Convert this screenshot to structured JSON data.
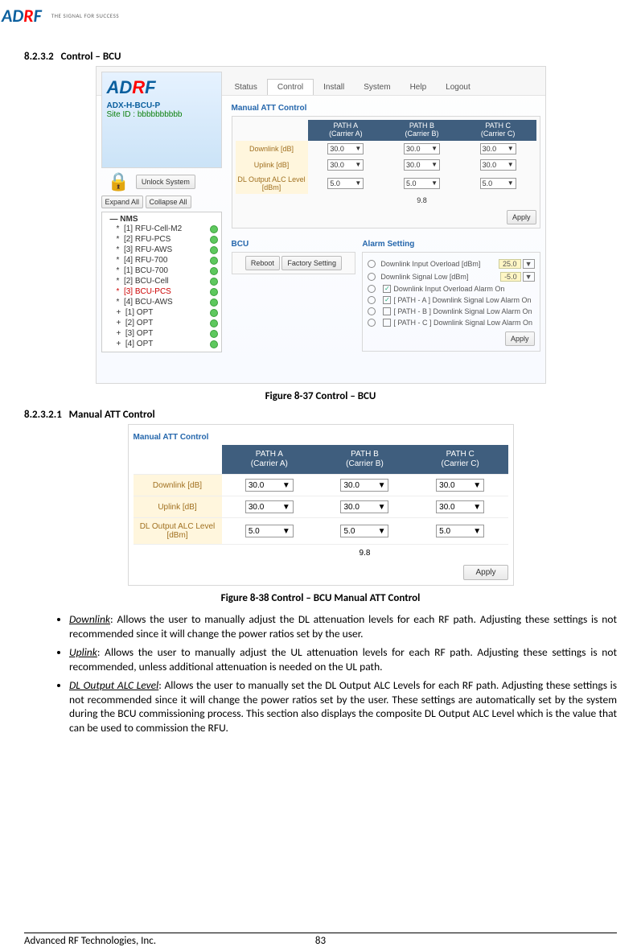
{
  "header": {
    "logo_text_AD": "AD",
    "logo_text_R": "R",
    "logo_text_F": "F",
    "logo_tagline": "THE SIGNAL FOR SUCCESS"
  },
  "section": {
    "num": "8.2.3.2",
    "title": "Control – BCU"
  },
  "figure1": {
    "caption": "Figure 8-37    Control – BCU",
    "tabs": [
      "Status",
      "Control",
      "Install",
      "System",
      "Help",
      "Logout"
    ],
    "active_tab": "Control",
    "device_name": "ADX-H-BCU-P",
    "site_id_label": "Site ID :",
    "site_id_value": "bbbbbbbbbb",
    "unlock_btn": "Unlock System",
    "expand_btn": "Expand All",
    "collapse_btn": "Collapse All",
    "tree_root": "NMS",
    "tree_items": [
      {
        "symbol": "*",
        "label": "[1] RFU-Cell-M2",
        "sel": false
      },
      {
        "symbol": "*",
        "label": "[2] RFU-PCS",
        "sel": false
      },
      {
        "symbol": "*",
        "label": "[3] RFU-AWS",
        "sel": false
      },
      {
        "symbol": "*",
        "label": "[4] RFU-700",
        "sel": false
      },
      {
        "symbol": "*",
        "label": "[1] BCU-700",
        "sel": false
      },
      {
        "symbol": "*",
        "label": "[2] BCU-Cell",
        "sel": false
      },
      {
        "symbol": "*",
        "label": "[3] BCU-PCS",
        "sel": true
      },
      {
        "symbol": "*",
        "label": "[4] BCU-AWS",
        "sel": false
      },
      {
        "symbol": "+",
        "label": "[1] OPT",
        "sel": false
      },
      {
        "symbol": "+",
        "label": "[2] OPT",
        "sel": false
      },
      {
        "symbol": "+",
        "label": "[3] OPT",
        "sel": false
      },
      {
        "symbol": "+",
        "label": "[4] OPT",
        "sel": false
      }
    ],
    "panel_title": "Manual ATT Control",
    "path_headers": [
      {
        "line1": "PATH A",
        "line2": "(Carrier A)"
      },
      {
        "line1": "PATH B",
        "line2": "(Carrier B)"
      },
      {
        "line1": "PATH C",
        "line2": "(Carrier C)"
      }
    ],
    "rows": [
      {
        "label": "Downlink [dB]",
        "vals": [
          "30.0",
          "30.0",
          "30.0"
        ]
      },
      {
        "label": "Uplink [dB]",
        "vals": [
          "30.0",
          "30.0",
          "30.0"
        ]
      },
      {
        "label": "DL Output ALC Level [dBm]",
        "vals": [
          "5.0",
          "5.0",
          "5.0"
        ]
      }
    ],
    "composite": "9.8",
    "apply": "Apply",
    "bcu_title": "BCU",
    "reboot": "Reboot",
    "factory": "Factory Setting",
    "alarm_title": "Alarm Setting",
    "alarm_rows": [
      {
        "radio": true,
        "text": "Downlink Input Overload [dBm]",
        "box": "25.0",
        "dd": true
      },
      {
        "radio": true,
        "text": "Downlink Signal Low [dBm]",
        "box": "-5.0",
        "dd": true
      },
      {
        "radio": true,
        "chk": true,
        "text": "Downlink Input Overload Alarm On"
      },
      {
        "radio": true,
        "chk": true,
        "text": "[ PATH - A ] Downlink Signal Low Alarm On"
      },
      {
        "radio": true,
        "chk": false,
        "text": "[ PATH - B ] Downlink Signal Low Alarm On"
      },
      {
        "radio": true,
        "chk": false,
        "text": "[ PATH - C ] Downlink Signal Low Alarm On"
      }
    ]
  },
  "subsection": {
    "num": "8.2.3.2.1",
    "title": "Manual ATT Control"
  },
  "figure2": {
    "caption": "Figure 8-38    Control – BCU Manual ATT Control",
    "panel_title": "Manual ATT Control",
    "path_headers": [
      {
        "line1": "PATH A",
        "line2": "(Carrier A)"
      },
      {
        "line1": "PATH B",
        "line2": "(Carrier B)"
      },
      {
        "line1": "PATH C",
        "line2": "(Carrier C)"
      }
    ],
    "rows": [
      {
        "label": "Downlink [dB]",
        "vals": [
          "30.0",
          "30.0",
          "30.0"
        ]
      },
      {
        "label": "Uplink [dB]",
        "vals": [
          "30.0",
          "30.0",
          "30.0"
        ]
      },
      {
        "label": "DL Output ALC Level [dBm]",
        "vals": [
          "5.0",
          "5.0",
          "5.0"
        ]
      }
    ],
    "composite": "9.8",
    "apply": "Apply"
  },
  "bullets": [
    {
      "term": "Downlink",
      "text": ": Allows the user to manually adjust the DL attenuation levels for each RF path.  Adjusting these settings is not recommended since it will change the power ratios set by the user."
    },
    {
      "term": "Uplink",
      "text": ": Allows the user to manually adjust the UL attenuation levels for each RF path.  Adjusting these settings is not recommended, unless additional attenuation is needed on the UL path."
    },
    {
      "term": "DL Output ALC Level",
      "text": ": Allows the user to manually set the DL Output ALC Levels for each RF path.  Adjusting these settings is not recommended since it will change the power ratios set by the user.  These settings are automatically set by the system during the BCU commissioning process.  This section also displays the composite DL Output ALC Level which is the value that can be used to commission the RFU."
    }
  ],
  "footer": {
    "company": "Advanced RF Technologies, Inc.",
    "page": "83"
  }
}
